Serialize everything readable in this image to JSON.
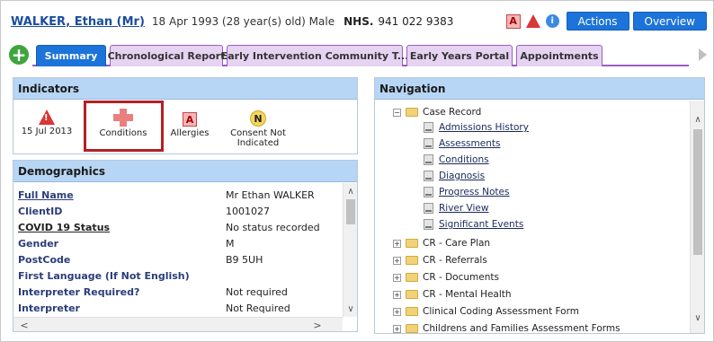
{
  "header": {
    "patient_name": "WALKER, Ethan (Mr)",
    "patient_info": "18 Apr 1993 (28 year(s) old)  Male",
    "nhs_label": "NHS.",
    "nhs_number": "941 022 9383",
    "alert_badge": "A",
    "warning_glyph": "!",
    "info_glyph": "i",
    "actions_label": "Actions",
    "overview_label": "Overview"
  },
  "tabs": [
    {
      "label": "Summary",
      "active": true
    },
    {
      "label": "Chronological Report",
      "active": false
    },
    {
      "label": "Early Intervention Community T...",
      "active": false
    },
    {
      "label": "Early Years Portal",
      "active": false
    },
    {
      "label": "Appointments",
      "active": false
    }
  ],
  "add_glyph": "+",
  "indicators": {
    "title": "Indicators",
    "items": [
      {
        "label": "15 Jul 2013",
        "icon": "warning-icon",
        "glyph": "!"
      },
      {
        "label": "Conditions",
        "icon": "cross-icon"
      },
      {
        "label": "Allergies",
        "icon": "allergy-icon",
        "glyph": "A"
      },
      {
        "label": "Consent Not Indicated",
        "icon": "consent-icon",
        "glyph": "N"
      }
    ]
  },
  "demographics": {
    "title": "Demographics",
    "rows": [
      {
        "label": "Full Name",
        "value": "Mr Ethan WALKER"
      },
      {
        "label": "ClientID",
        "value": "1001027"
      },
      {
        "label": "COVID 19 Status",
        "value": "No status recorded"
      },
      {
        "label": "Gender",
        "value": "M"
      },
      {
        "label": "PostCode",
        "value": "B9 5UH"
      },
      {
        "label": "First Language (If Not English)",
        "value": ""
      },
      {
        "label": "Interpreter Required?",
        "value": "Not required"
      },
      {
        "label": "Interpreter",
        "value": "Not Required"
      }
    ]
  },
  "navigation": {
    "title": "Navigation",
    "root": {
      "label": "Case Record",
      "expander": "−"
    },
    "children": [
      "Admissions History",
      "Assessments",
      "Conditions",
      "Diagnosis",
      "Progress Notes",
      "River View",
      "Significant Events"
    ],
    "folders": [
      "CR - Care Plan",
      "CR - Referrals",
      "CR - Documents",
      "CR - Mental Health",
      "Clinical Coding Assessment Form",
      "Childrens and Families Assessment Forms"
    ],
    "folder_expander": "+"
  },
  "scroll_glyphs": {
    "up": "∧",
    "down": "∨",
    "left": "<",
    "right": ">"
  }
}
